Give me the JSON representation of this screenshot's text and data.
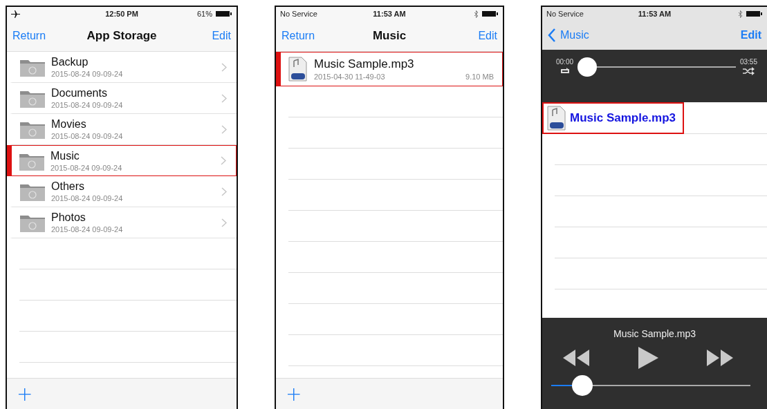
{
  "screens": [
    {
      "kind": "storage",
      "status": {
        "airplane_mode": true,
        "time": "12:50 PM",
        "battery": "61%"
      },
      "nav": {
        "back": "Return",
        "title": "App Storage",
        "action": "Edit"
      },
      "rows": [
        {
          "name": "Backup",
          "date": "2015-08-24 09-09-24",
          "selected": false
        },
        {
          "name": "Documents",
          "date": "2015-08-24 09-09-24",
          "selected": false
        },
        {
          "name": "Movies",
          "date": "2015-08-24 09-09-24",
          "selected": false
        },
        {
          "name": "Music",
          "date": "2015-08-24 09-09-24",
          "selected": true
        },
        {
          "name": "Others",
          "date": "2015-08-24 09-09-24",
          "selected": false
        },
        {
          "name": "Photos",
          "date": "2015-08-24 09-09-24",
          "selected": false
        }
      ],
      "toolbar": {
        "add": "+"
      }
    },
    {
      "kind": "files",
      "status": {
        "carrier": "No Service",
        "time": "11:53 AM"
      },
      "nav": {
        "back": "Return",
        "title": "Music",
        "action": "Edit"
      },
      "rows": [
        {
          "name": "Music Sample.mp3",
          "date": "2015-04-30 11-49-03",
          "size": "9.10 MB",
          "selected": true
        }
      ],
      "toolbar": {
        "add": "+"
      }
    },
    {
      "kind": "player",
      "status": {
        "carrier": "No Service",
        "time": "11:53 AM"
      },
      "nav": {
        "back": "Music",
        "action": "Edit"
      },
      "progress": {
        "elapsed": "00:00",
        "duration": "03:55",
        "level": 0
      },
      "rows": [
        {
          "name": "Music Sample.mp3",
          "selected": true
        }
      ],
      "now_playing": {
        "title": "Music Sample.mp3",
        "volume": {
          "level": 0.12
        }
      }
    }
  ]
}
